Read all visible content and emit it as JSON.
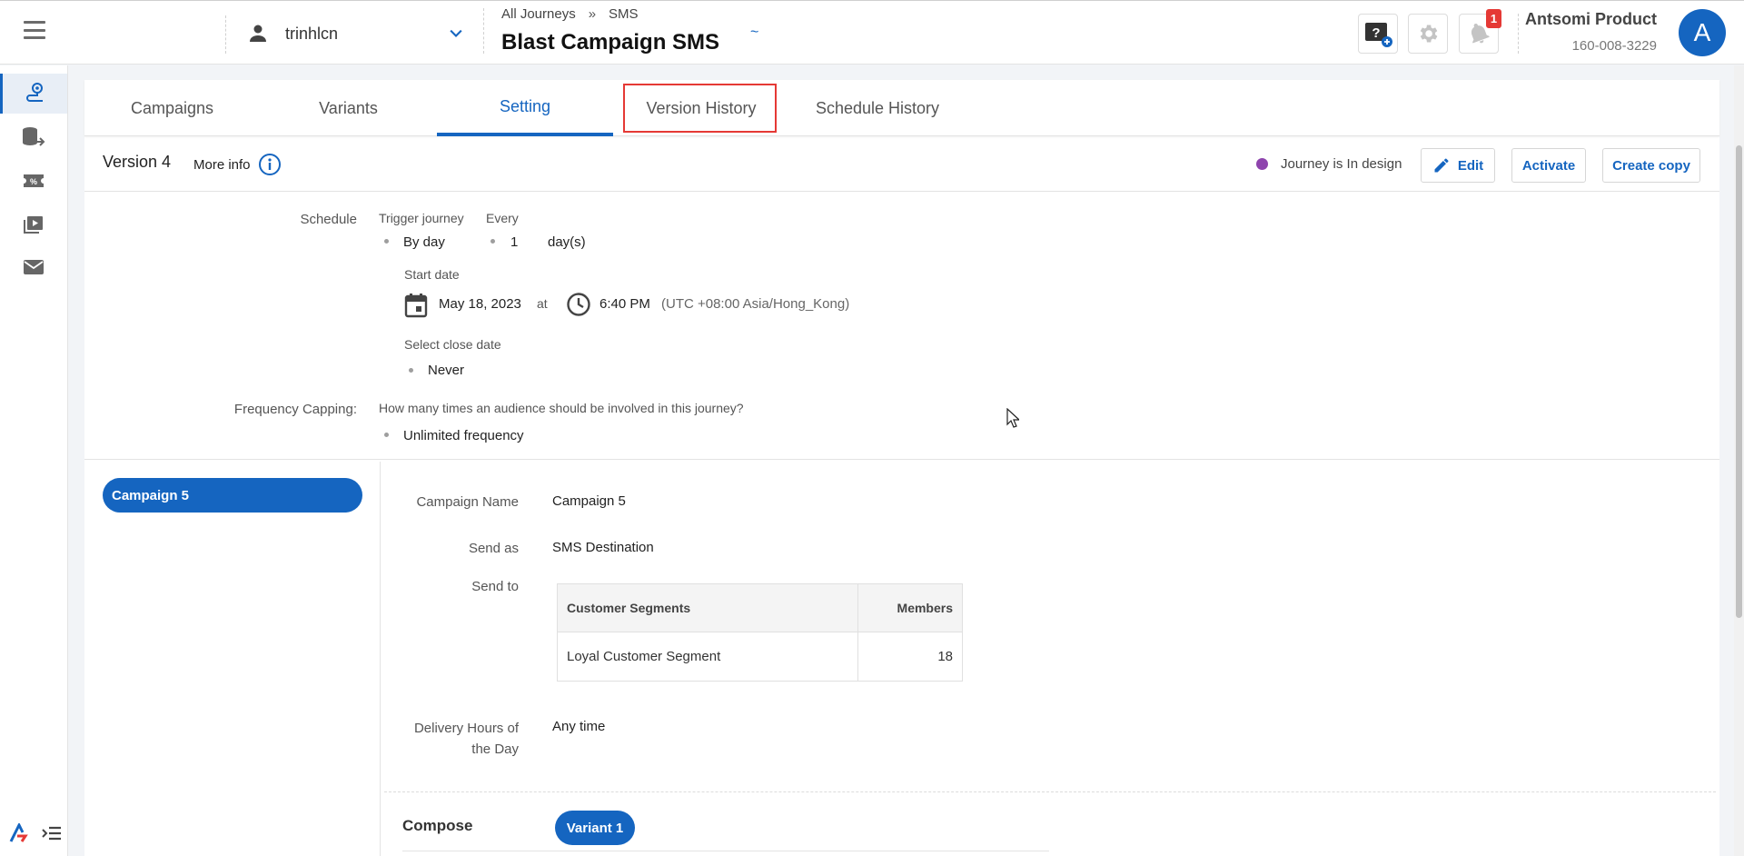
{
  "header": {
    "user": "trinhlcn",
    "breadcrumb": [
      "All Journeys",
      "SMS"
    ],
    "breadcrumb_separator": "»",
    "title": "Blast Campaign SMS",
    "loading_glyph": "~",
    "notification_count": "1",
    "account_name": "Antsomi Product",
    "account_id": "160-008-3229",
    "avatar_letter": "A"
  },
  "rail": {
    "items": [
      "journey-icon",
      "data-flow-icon",
      "promotion-icon",
      "media-icon",
      "mail-icon"
    ],
    "active_index": 0
  },
  "tabs": [
    {
      "label": "Campaigns"
    },
    {
      "label": "Variants"
    },
    {
      "label": "Setting"
    },
    {
      "label": "Version History"
    },
    {
      "label": "Schedule History"
    }
  ],
  "active_tab": "Setting",
  "version_bar": {
    "version": "Version 4",
    "more_info": "More info",
    "status": "Journey is In design",
    "status_color": "#8e44ad",
    "edit": "Edit",
    "activate": "Activate",
    "create_copy": "Create copy"
  },
  "schedule": {
    "label": "Schedule",
    "trigger_label": "Trigger journey",
    "trigger_value": "By day",
    "every_label": "Every",
    "every_value": "1",
    "every_unit": "day(s)",
    "start_date_label": "Start date",
    "start_date": "May 18, 2023",
    "at": "at",
    "start_time": "6:40 PM",
    "timezone": "(UTC +08:00 Asia/Hong_Kong)",
    "close_date_label": "Select close date",
    "close_date_value": "Never"
  },
  "frequency": {
    "label": "Frequency Capping:",
    "question": "How many times an audience should be involved in this journey?",
    "value": "Unlimited frequency"
  },
  "campaign_list": [
    "Campaign 5"
  ],
  "campaign_detail": {
    "name_label": "Campaign Name",
    "name": "Campaign 5",
    "send_as_label": "Send as",
    "send_as": "SMS Destination",
    "send_to_label": "Send to",
    "segments_header": "Customer Segments",
    "members_header": "Members",
    "segments": [
      {
        "name": "Loyal Customer Segment",
        "members": "18"
      }
    ],
    "delivery_label_1": "Delivery Hours of",
    "delivery_label_2": "the Day",
    "delivery_value": "Any time",
    "compose_label": "Compose",
    "variant": "Variant 1"
  },
  "colors": {
    "primary": "#1565c0",
    "highlight": "#e53935"
  }
}
